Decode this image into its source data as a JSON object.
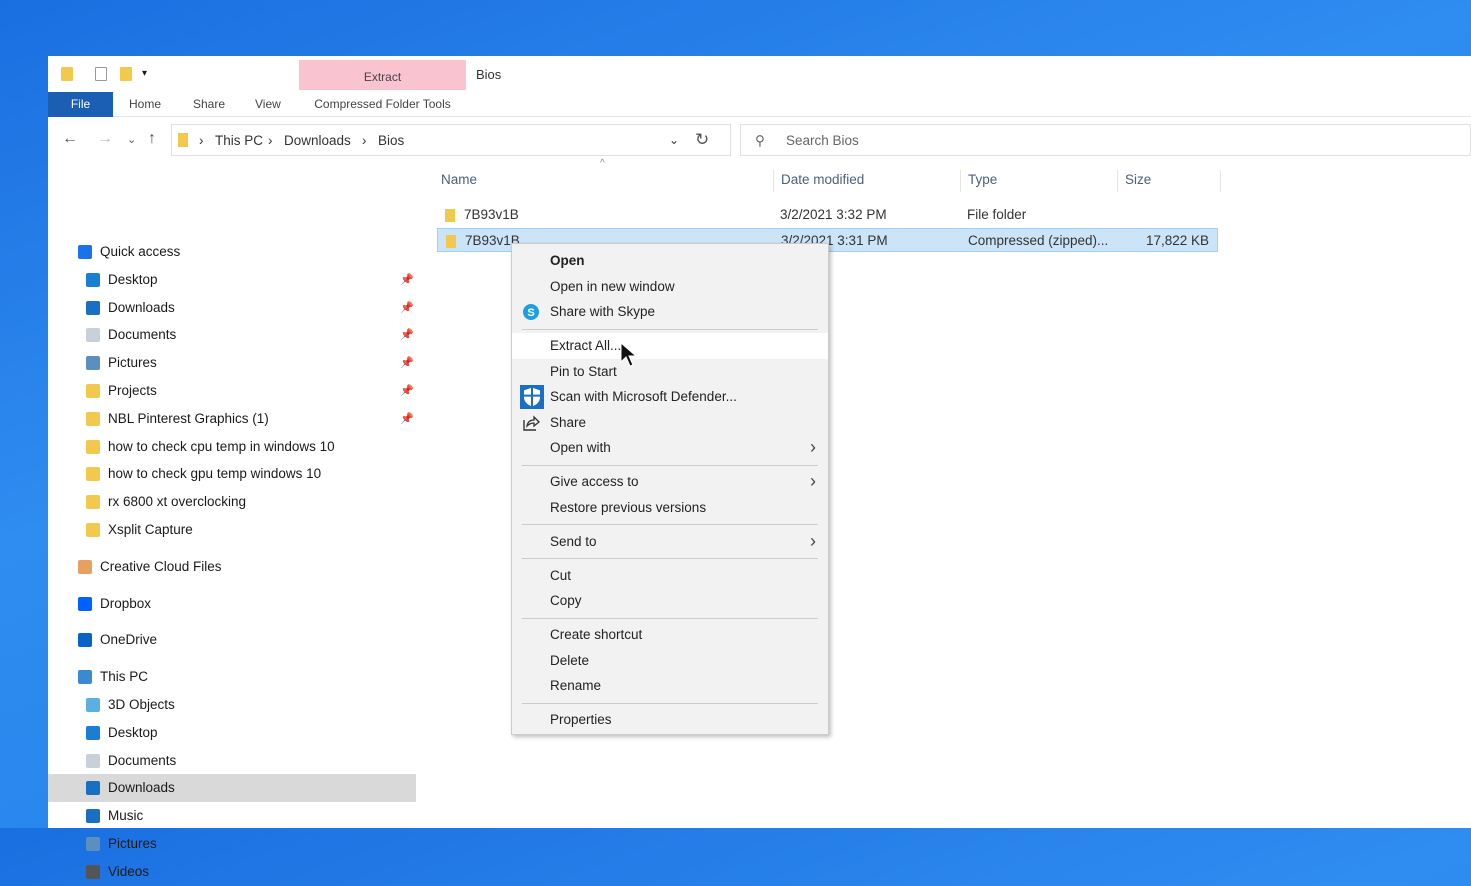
{
  "window": {
    "title": "Bios",
    "contextual_tab": "Extract"
  },
  "ribbon": {
    "tabs": [
      "File",
      "Home",
      "Share",
      "View",
      "Compressed Folder Tools"
    ]
  },
  "address": {
    "crumbs": [
      "This PC",
      "Downloads",
      "Bios"
    ]
  },
  "search": {
    "placeholder": "Search Bios"
  },
  "sidebar": {
    "items": [
      {
        "label": "Quick access",
        "level": 0,
        "icon": "star-icon",
        "color": "#1a73e8"
      },
      {
        "label": "Desktop",
        "level": 1,
        "icon": "desktop-icon",
        "color": "#1a7fd4",
        "pin": true
      },
      {
        "label": "Downloads",
        "level": 1,
        "icon": "download-icon",
        "color": "#1a6fc4",
        "pin": true
      },
      {
        "label": "Documents",
        "level": 1,
        "icon": "documents-icon",
        "color": "#c8d0da",
        "pin": true
      },
      {
        "label": "Pictures",
        "level": 1,
        "icon": "pictures-icon",
        "color": "#5a8fc0",
        "pin": true
      },
      {
        "label": "Projects",
        "level": 1,
        "icon": "folder-icon",
        "color": "#f2c94c",
        "pin": true
      },
      {
        "label": "NBL Pinterest Graphics (1)",
        "level": 1,
        "icon": "folder-icon",
        "color": "#f2c94c",
        "pin": true
      },
      {
        "label": "how to check cpu temp in windows 10",
        "level": 1,
        "icon": "folder-icon",
        "color": "#f2c94c"
      },
      {
        "label": "how to check gpu temp windows 10",
        "level": 1,
        "icon": "folder-icon",
        "color": "#f2c94c"
      },
      {
        "label": "rx 6800 xt overclocking",
        "level": 1,
        "icon": "folder-icon",
        "color": "#f2c94c"
      },
      {
        "label": "Xsplit Capture",
        "level": 1,
        "icon": "folder-icon",
        "color": "#f2c94c"
      },
      {
        "label": "Creative Cloud Files",
        "level": 0,
        "icon": "creative-cloud-icon",
        "color": "#e8a060",
        "gap": true
      },
      {
        "label": "Dropbox",
        "level": 0,
        "icon": "dropbox-icon",
        "color": "#0061fe",
        "gap": true
      },
      {
        "label": "OneDrive",
        "level": 0,
        "icon": "onedrive-icon",
        "color": "#0a64c8",
        "gap": true
      },
      {
        "label": "This PC",
        "level": 0,
        "icon": "computer-icon",
        "color": "#3a8ad0",
        "gap": true
      },
      {
        "label": "3D Objects",
        "level": 1,
        "icon": "3d-objects-icon",
        "color": "#5ab0e0"
      },
      {
        "label": "Desktop",
        "level": 1,
        "icon": "desktop-icon",
        "color": "#1a7fd4"
      },
      {
        "label": "Documents",
        "level": 1,
        "icon": "documents-icon",
        "color": "#c8d0da"
      },
      {
        "label": "Downloads",
        "level": 1,
        "icon": "download-icon",
        "color": "#1a6fc4",
        "selected": true
      },
      {
        "label": "Music",
        "level": 1,
        "icon": "music-icon",
        "color": "#1a6fc4"
      },
      {
        "label": "Pictures",
        "level": 1,
        "icon": "pictures-icon",
        "color": "#5a8fc0"
      },
      {
        "label": "Videos",
        "level": 1,
        "icon": "videos-icon",
        "color": "#555"
      }
    ]
  },
  "columns": [
    "Name",
    "Date modified",
    "Type",
    "Size"
  ],
  "files": [
    {
      "name": "7B93v1B",
      "date": "3/2/2021 3:32 PM",
      "type": "File folder",
      "size": ""
    },
    {
      "name": "7B93v1B",
      "date": "3/2/2021 3:31 PM",
      "type": "Compressed (zipped)...",
      "size": "17,822 KB",
      "selected": true
    }
  ],
  "context_menu": [
    {
      "label": "Open",
      "bold": true
    },
    {
      "label": "Open in new window"
    },
    {
      "label": "Share with Skype",
      "icon": "skype-icon"
    },
    {
      "sep": true
    },
    {
      "label": "Extract All...",
      "hot": true
    },
    {
      "label": "Pin to Start"
    },
    {
      "label": "Scan with Microsoft Defender...",
      "icon": "defender-icon"
    },
    {
      "label": "Share",
      "icon": "share-icon"
    },
    {
      "label": "Open with",
      "submenu": true
    },
    {
      "sep": true
    },
    {
      "label": "Give access to",
      "submenu": true
    },
    {
      "label": "Restore previous versions"
    },
    {
      "sep": true
    },
    {
      "label": "Send to",
      "submenu": true
    },
    {
      "sep": true
    },
    {
      "label": "Cut"
    },
    {
      "label": "Copy"
    },
    {
      "sep": true
    },
    {
      "label": "Create shortcut"
    },
    {
      "label": "Delete"
    },
    {
      "label": "Rename"
    },
    {
      "sep": true
    },
    {
      "label": "Properties"
    }
  ]
}
